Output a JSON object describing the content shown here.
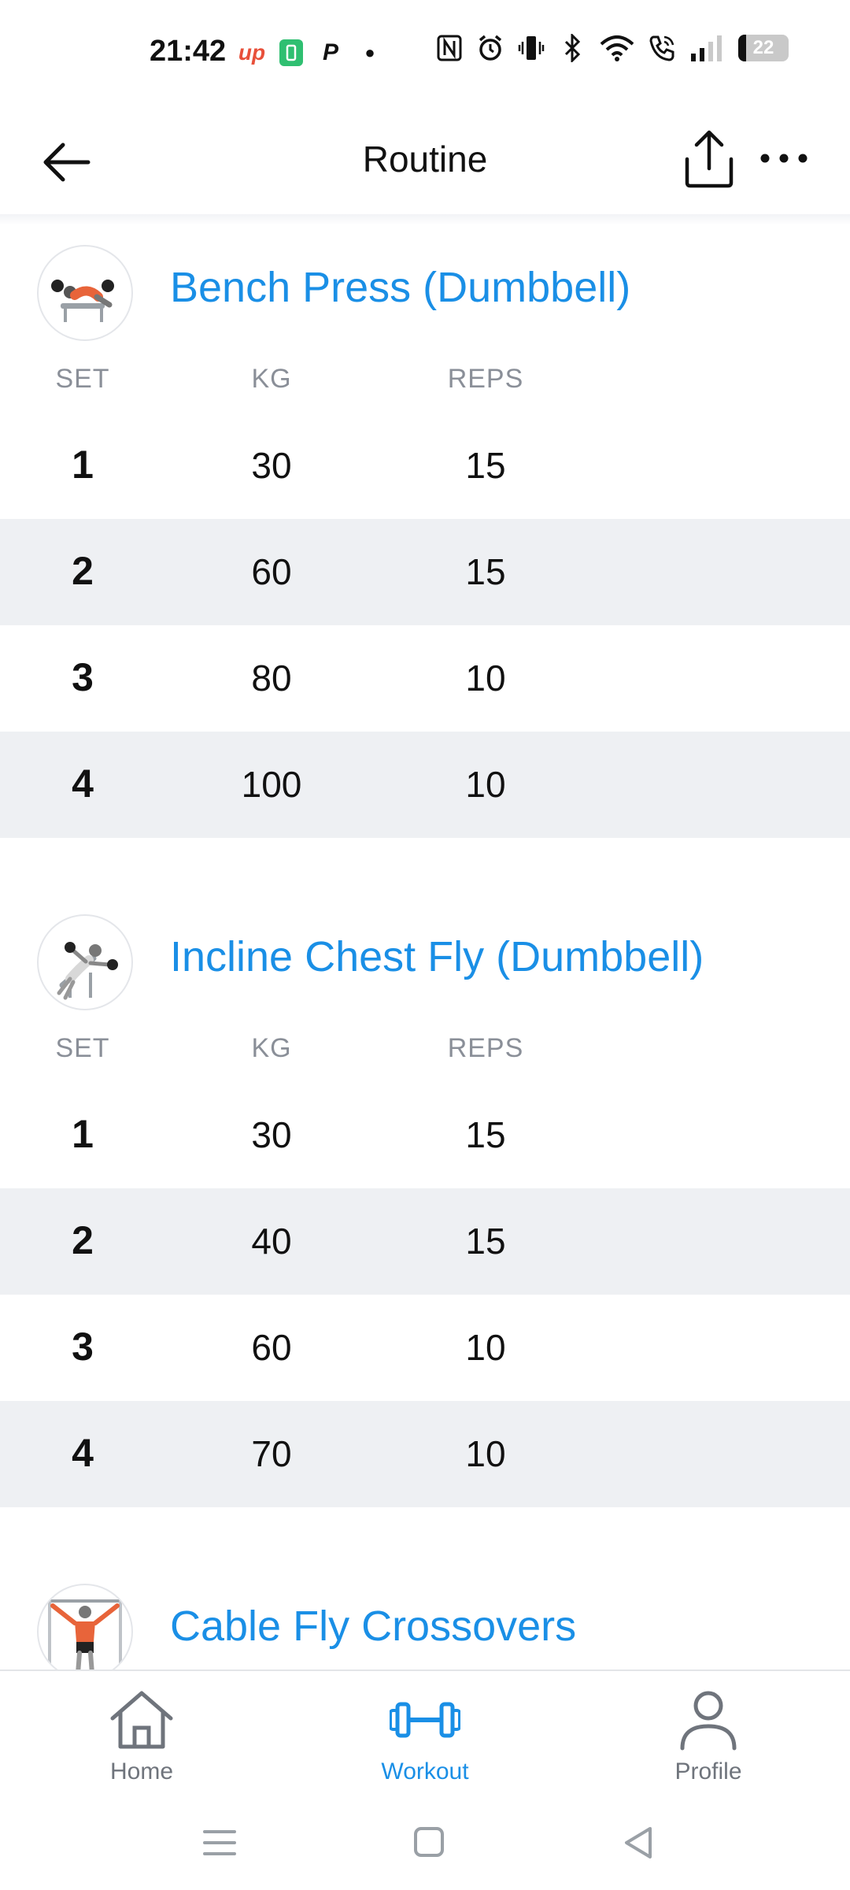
{
  "status_bar": {
    "time": "21:42",
    "battery": "22",
    "left_icons": [
      "up-app-icon",
      "battery-saver-icon",
      "paypal-icon",
      "dot-icon"
    ],
    "right_icons": [
      "nfc-icon",
      "alarm-icon",
      "vibrate-icon",
      "bluetooth-icon",
      "wifi-icon",
      "call-icon",
      "signal-icon",
      "battery-icon"
    ]
  },
  "header": {
    "title": "Routine",
    "back_icon": "arrow-left-icon",
    "share_icon": "share-icon",
    "more_icon": "more-horizontal-icon"
  },
  "columns": {
    "set": "SET",
    "kg": "KG",
    "reps": "REPS"
  },
  "exercises": [
    {
      "name": "Bench Press (Dumbbell)",
      "sets": [
        {
          "set": "1",
          "kg": "30",
          "reps": "15"
        },
        {
          "set": "2",
          "kg": "60",
          "reps": "15"
        },
        {
          "set": "3",
          "kg": "80",
          "reps": "10"
        },
        {
          "set": "4",
          "kg": "100",
          "reps": "10"
        }
      ]
    },
    {
      "name": "Incline Chest Fly (Dumbbell)",
      "sets": [
        {
          "set": "1",
          "kg": "30",
          "reps": "15"
        },
        {
          "set": "2",
          "kg": "40",
          "reps": "15"
        },
        {
          "set": "3",
          "kg": "60",
          "reps": "10"
        },
        {
          "set": "4",
          "kg": "70",
          "reps": "10"
        }
      ]
    },
    {
      "name": "Cable Fly Crossovers",
      "sets": []
    }
  ],
  "bottom_nav": {
    "home": "Home",
    "workout": "Workout",
    "profile": "Profile",
    "active": "workout"
  },
  "colors": {
    "accent": "#1a8fe6",
    "row_alt": "#eef0f3",
    "muted": "#8a8f98"
  }
}
